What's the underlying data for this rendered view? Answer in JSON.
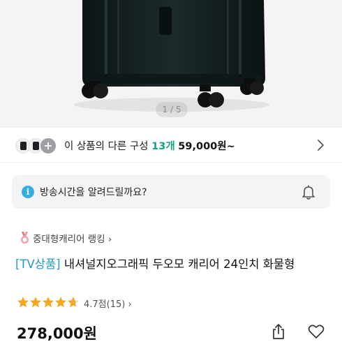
{
  "hero": {
    "image_alt": "black carry-on suitcase",
    "pager": "1 / 5"
  },
  "options": {
    "thumb_icons": [
      "suitcase-thumb-icon",
      "suitcase-thumb-icon",
      "plus-icon"
    ],
    "more_symbol": "+",
    "label": "이 상품의 다른 구성",
    "count": "13개",
    "price_from": "59,000원~",
    "count_color": "#16a085"
  },
  "alert": {
    "icon": "info-icon",
    "icon_symbol": "i",
    "text": "방송시간을 알려드릴까요?",
    "bell_icon": "bell-icon",
    "bg_color": "#f2f4f6"
  },
  "ranking": {
    "icon": "medal-icon",
    "label": "중대형캐리어 랭킹 ›"
  },
  "product": {
    "tag": "[TV상품]",
    "tag_color": "#1f98c4",
    "name": " 내셔널지오그래픽 두오모 캐리어 24인치 화물형",
    "rating_value": 4.7,
    "rating_max": 5,
    "rating_text": "4.7점(15) ›",
    "price": "278,000원"
  },
  "actions": {
    "share_icon": "share-icon",
    "wishlist_icon": "heart-icon"
  },
  "colors": {
    "star": "#f5a623",
    "accent_blue": "#34aee0"
  }
}
